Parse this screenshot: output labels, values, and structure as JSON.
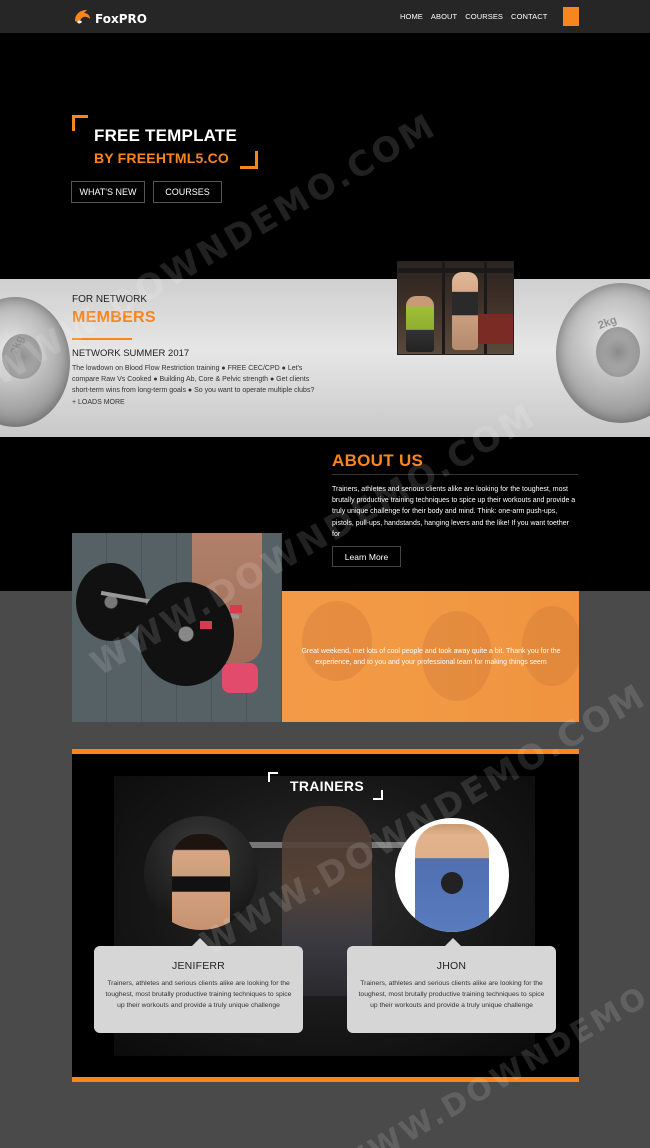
{
  "nav": {
    "brand": "FoxPRO",
    "links": [
      "HOME",
      "ABOUT",
      "COURSES",
      "CONTACT"
    ]
  },
  "hero": {
    "title": "FREE TEMPLATE",
    "subtitle": "BY FREEHTML5.CO",
    "buttons": [
      "WHAT'S NEW",
      "COURSES"
    ]
  },
  "members": {
    "eyebrow": "FOR NETWORK",
    "title": "MEMBERS",
    "subtitle": "NETWORK SUMMER 2017",
    "body": "The lowdown on Blood Flow Restriction training ● FREE CEC/CPD ● Let's compare Raw Vs Cooked ● Building Ab, Core & Pelvic strength ● Get clients short-term wins from long-term goals ● So you want to operate multiple clubs? + LOADS MORE",
    "plate_label": "2kg"
  },
  "about": {
    "title": "ABOUT US",
    "body": "Trainers, athletes and serious clients alike are looking for the toughest, most brutally productive training techniques to spice up their workouts and provide a truly unique challenge for their body and mind. Think: one-arm push-ups, pistols, pull-ups, handstands, hanging levers and the like! If you want toether for",
    "button": "Learn More"
  },
  "testimonial": {
    "text": "Great weekend, met lots of cool people and took away quite a bit. Thank you for the experience, and to you and your professional team for making things seem"
  },
  "trainers": {
    "title": "TRAINERS",
    "people": [
      {
        "name": "JENIFERR",
        "bio": "Trainers, athletes and serious clients alike are looking for the toughest, most brutally productive training techniques to spice up their workouts and provide a truly unique challenge"
      },
      {
        "name": "JHON",
        "bio": "Trainers, athletes and serious clients alike are looking for the toughest, most brutally productive training techniques to spice up their workouts and provide a truly unique challenge"
      }
    ]
  },
  "watermark": "WWW.DOWNDEMO.COM",
  "colors": {
    "accent": "#f7861e",
    "nav_bg": "#262626",
    "page_bg": "#4a4a4a"
  }
}
